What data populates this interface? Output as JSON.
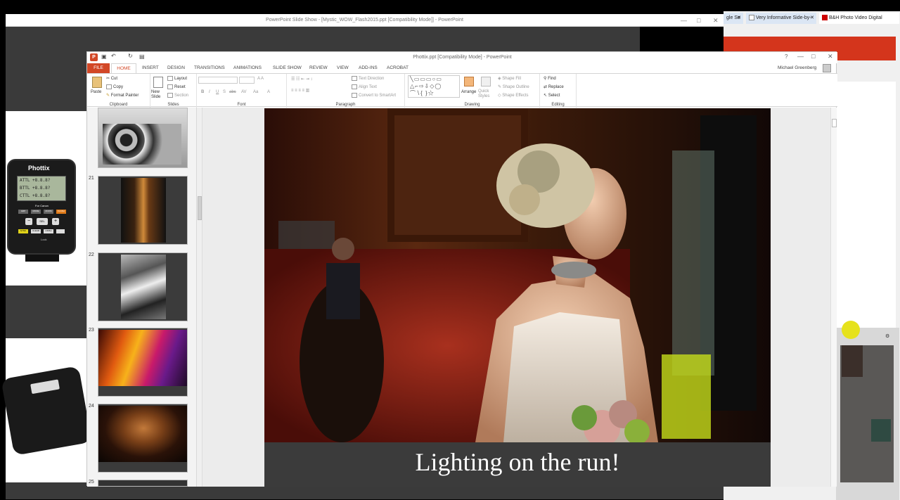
{
  "background_window": {
    "title": "PowerPoint Slide Show - [Mystic_WOW_Flash2015.ppt [Compatibility Mode]] - PowerPoint",
    "controls": [
      "—",
      "□",
      "✕"
    ],
    "flash_brand": "Phottix",
    "flash_lcd_lines": [
      "ATTL +8.8.8?",
      "BTTL +8.8.8?",
      "CTTL +8.8.8?"
    ],
    "flash_caption": "For Canon",
    "flash_buttons": [
      "GRP",
      "MODE",
      "ZOOM",
      "FLASH",
      "SEL",
      "SYNC",
      "CLEAR",
      "HS/SH"
    ],
    "flash_lock": "Lock"
  },
  "browser": {
    "tabs": [
      {
        "label": "gle Se",
        "close": "✕"
      },
      {
        "label": "Very Informative Side-by-",
        "close": "✕"
      },
      {
        "label": "B&H Photo Video Digital",
        "close": "✕"
      }
    ]
  },
  "ppt": {
    "title": "Phottix.ppt [Compatibility Mode] - PowerPoint",
    "help": "?",
    "user_name": "Michael Greenberg",
    "window_controls": [
      "—",
      "□",
      "✕"
    ],
    "tabs": [
      "FILE",
      "HOME",
      "INSERT",
      "DESIGN",
      "TRANSITIONS",
      "ANIMATIONS",
      "SLIDE SHOW",
      "REVIEW",
      "VIEW",
      "ADD-INS",
      "ACROBAT"
    ],
    "ribbon": {
      "clipboard": {
        "label": "Clipboard",
        "paste": "Paste",
        "cut": "Cut",
        "copy": "Copy",
        "format_painter": "Format Painter"
      },
      "slides": {
        "label": "Slides",
        "new_slide": "New Slide",
        "layout": "Layout",
        "reset": "Reset",
        "section": "Section"
      },
      "font": {
        "label": "Font",
        "styles": [
          "B",
          "I",
          "U",
          "S",
          "abc",
          "AV",
          "Aa",
          "A"
        ]
      },
      "paragraph": {
        "label": "Paragraph",
        "text_direction": "Text Direction",
        "align_text": "Align Text",
        "convert_smartart": "Convert to SmartArt"
      },
      "drawing": {
        "label": "Drawing",
        "arrange": "Arrange",
        "quick_styles": "Quick Styles",
        "shape_fill": "Shape Fill",
        "shape_outline": "Shape Outline",
        "shape_effects": "Shape Effects"
      },
      "editing": {
        "label": "Editing",
        "find": "Find",
        "replace": "Replace",
        "select": "Select"
      }
    },
    "thumbnails": [
      "21",
      "22",
      "23",
      "24",
      "25"
    ],
    "slide_caption": "Lighting on the run!"
  }
}
